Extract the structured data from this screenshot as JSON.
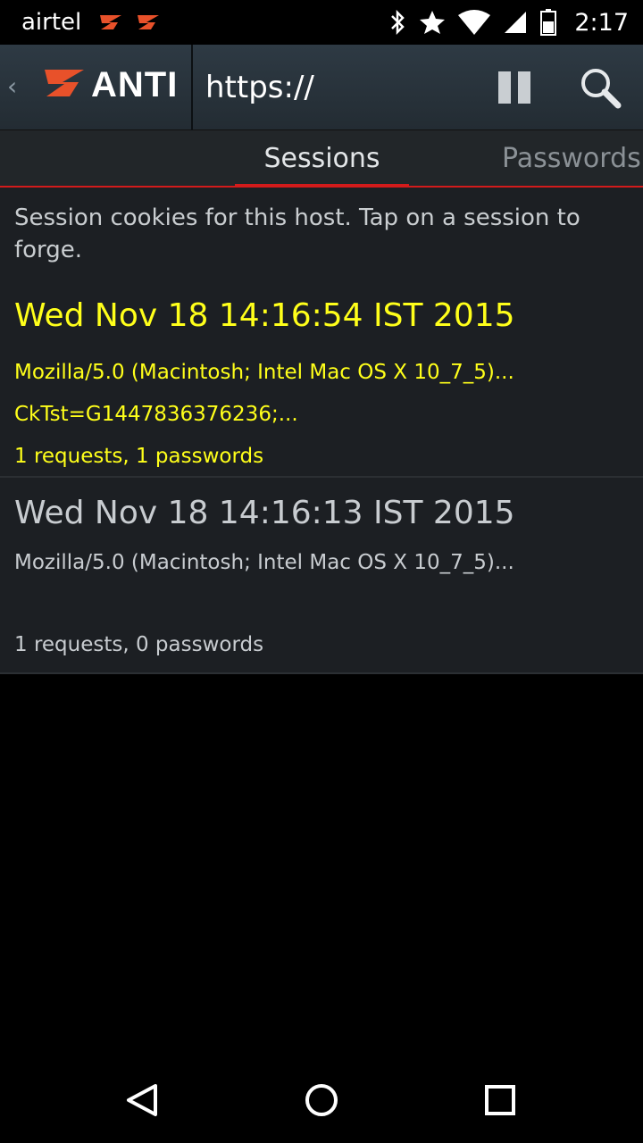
{
  "status_bar": {
    "carrier": "airtel",
    "time": "2:17",
    "icons": [
      "zanti-notification-icon",
      "zanti-notification-icon",
      "bluetooth-icon",
      "star-icon",
      "wifi-icon",
      "signal-icon",
      "battery-icon"
    ]
  },
  "action_bar": {
    "logo_text": "ANTI",
    "url_value": "https://",
    "brand_color": "#e8512a"
  },
  "tabs": [
    {
      "label": "Sessions",
      "active": true
    },
    {
      "label": "Passwords",
      "active": false
    }
  ],
  "accent_color": "#d31b1b",
  "intro_text": "Session cookies for this host. Tap on a session to forge.",
  "sessions": [
    {
      "date": "Wed Nov 18 14:16:54 IST 2015",
      "user_agent": "Mozilla/5.0 (Macintosh; Intel Mac OS X 10_7_5)...",
      "cookie": "CkTst=G1447836376236;...",
      "stats": "1 requests, 1 passwords",
      "highlight_color": "#ffff1a"
    },
    {
      "date": "Wed Nov 18 14:16:13 IST 2015",
      "user_agent": "Mozilla/5.0 (Macintosh; Intel Mac OS X 10_7_5)...",
      "cookie": "",
      "stats": "1 requests, 0 passwords"
    }
  ]
}
